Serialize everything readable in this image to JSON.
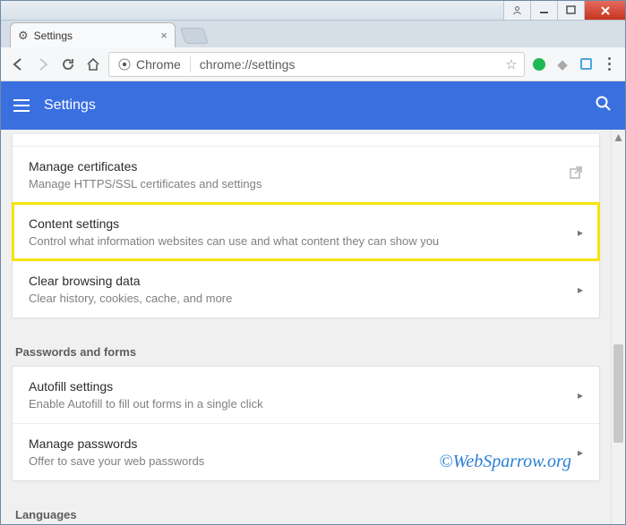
{
  "window": {
    "tab_title": "Settings",
    "omnibox_origin": "Chrome",
    "omnibox_url": "chrome://settings"
  },
  "header": {
    "title": "Settings"
  },
  "cards": {
    "privacy": [
      {
        "title": "Manage certificates",
        "sub": "Manage HTTPS/SSL certificates and settings",
        "action": "external"
      },
      {
        "title": "Content settings",
        "sub": "Control what information websites can use and what content they can show you",
        "action": "caret",
        "highlight": true
      },
      {
        "title": "Clear browsing data",
        "sub": "Clear history, cookies, cache, and more",
        "action": "caret"
      }
    ],
    "passwords_label": "Passwords and forms",
    "passwords": [
      {
        "title": "Autofill settings",
        "sub": "Enable Autofill to fill out forms in a single click",
        "action": "caret"
      },
      {
        "title": "Manage passwords",
        "sub": "Offer to save your web passwords",
        "action": "caret"
      }
    ],
    "languages_label": "Languages"
  },
  "watermark": "©WebSparrow.org"
}
